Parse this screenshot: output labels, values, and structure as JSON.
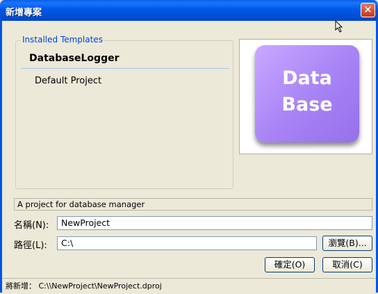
{
  "window": {
    "title": "新增專案",
    "close_symbol": "✕"
  },
  "templates": {
    "group_label": "Installed Templates",
    "header": "DatabaseLogger",
    "items": [
      "Default Project"
    ]
  },
  "preview": {
    "line1": "Data",
    "line2": "Base"
  },
  "description": "A project for database manager",
  "name_field": {
    "label": "名稱(N):",
    "value": "NewProject"
  },
  "path_field": {
    "label": "路徑(L):",
    "value": "C:\\"
  },
  "buttons": {
    "browse": "瀏覽(B)...",
    "ok": "確定(O)",
    "cancel": "取消(C)"
  },
  "status": {
    "label": "將新增：",
    "value": "C:\\\\NewProject\\NewProject.dproj"
  },
  "colors": {
    "title_bar": "#0055e5",
    "icon_purple": "#a782f5",
    "group_label": "#0046d5"
  }
}
